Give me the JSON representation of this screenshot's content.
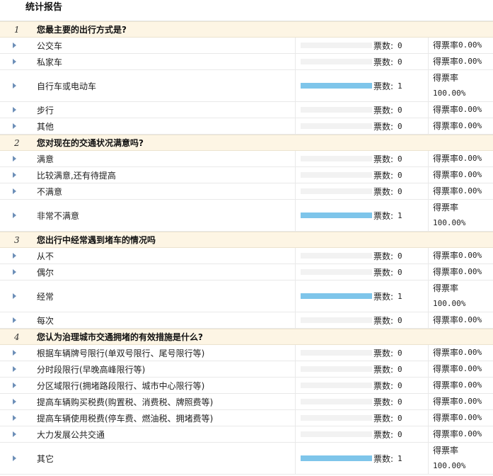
{
  "page": {
    "title": "统计报告"
  },
  "labels": {
    "votes_prefix": "票数:",
    "rate_prefix": "得票率"
  },
  "colors": {
    "bar_fill": "#7ec5ea",
    "bar_track": "#f2f2f2",
    "question_bg": "#fdf5e4",
    "arrow": "#6d8fb8"
  },
  "questions": [
    {
      "number": "1",
      "text": "您最主要的出行方式是?",
      "options": [
        {
          "label": "公交车",
          "votes": "0",
          "rate": "0.00%",
          "share": 0
        },
        {
          "label": "私家车",
          "votes": "0",
          "rate": "0.00%",
          "share": 0
        },
        {
          "label": "自行车或电动车",
          "votes": "1",
          "rate": "100.00%",
          "share": 1
        },
        {
          "label": "步行",
          "votes": "0",
          "rate": "0.00%",
          "share": 0
        },
        {
          "label": "其他",
          "votes": "0",
          "rate": "0.00%",
          "share": 0
        }
      ]
    },
    {
      "number": "2",
      "text": "您对现在的交通状况满意吗?",
      "options": [
        {
          "label": "满意",
          "votes": "0",
          "rate": "0.00%",
          "share": 0
        },
        {
          "label": "比较满意,还有待提高",
          "votes": "0",
          "rate": "0.00%",
          "share": 0
        },
        {
          "label": "不满意",
          "votes": "0",
          "rate": "0.00%",
          "share": 0
        },
        {
          "label": "非常不满意",
          "votes": "1",
          "rate": "100.00%",
          "share": 1
        }
      ]
    },
    {
      "number": "3",
      "text": "您出行中经常遇到堵车的情况吗",
      "options": [
        {
          "label": "从不",
          "votes": "0",
          "rate": "0.00%",
          "share": 0
        },
        {
          "label": "偶尔",
          "votes": "0",
          "rate": "0.00%",
          "share": 0
        },
        {
          "label": "经常",
          "votes": "1",
          "rate": "100.00%",
          "share": 1
        },
        {
          "label": "每次",
          "votes": "0",
          "rate": "0.00%",
          "share": 0
        }
      ]
    },
    {
      "number": "4",
      "text": "您认为治理城市交通拥堵的有效措施是什么?",
      "options": [
        {
          "label": "根据车辆牌号限行(单双号限行、尾号限行等)",
          "votes": "0",
          "rate": "0.00%",
          "share": 0
        },
        {
          "label": "分时段限行(早晚高峰限行等)",
          "votes": "0",
          "rate": "0.00%",
          "share": 0
        },
        {
          "label": "分区域限行(拥堵路段限行、城市中心限行等)",
          "votes": "0",
          "rate": "0.00%",
          "share": 0
        },
        {
          "label": "提高车辆购买税费(购置税、消费税、牌照费等)",
          "votes": "0",
          "rate": "0.00%",
          "share": 0
        },
        {
          "label": "提高车辆使用税费(停车费、燃油税、拥堵费等)",
          "votes": "0",
          "rate": "0.00%",
          "share": 0
        },
        {
          "label": "大力发展公共交通",
          "votes": "0",
          "rate": "0.00%",
          "share": 0
        },
        {
          "label": "其它",
          "votes": "1",
          "rate": "100.00%",
          "share": 1
        }
      ]
    }
  ]
}
